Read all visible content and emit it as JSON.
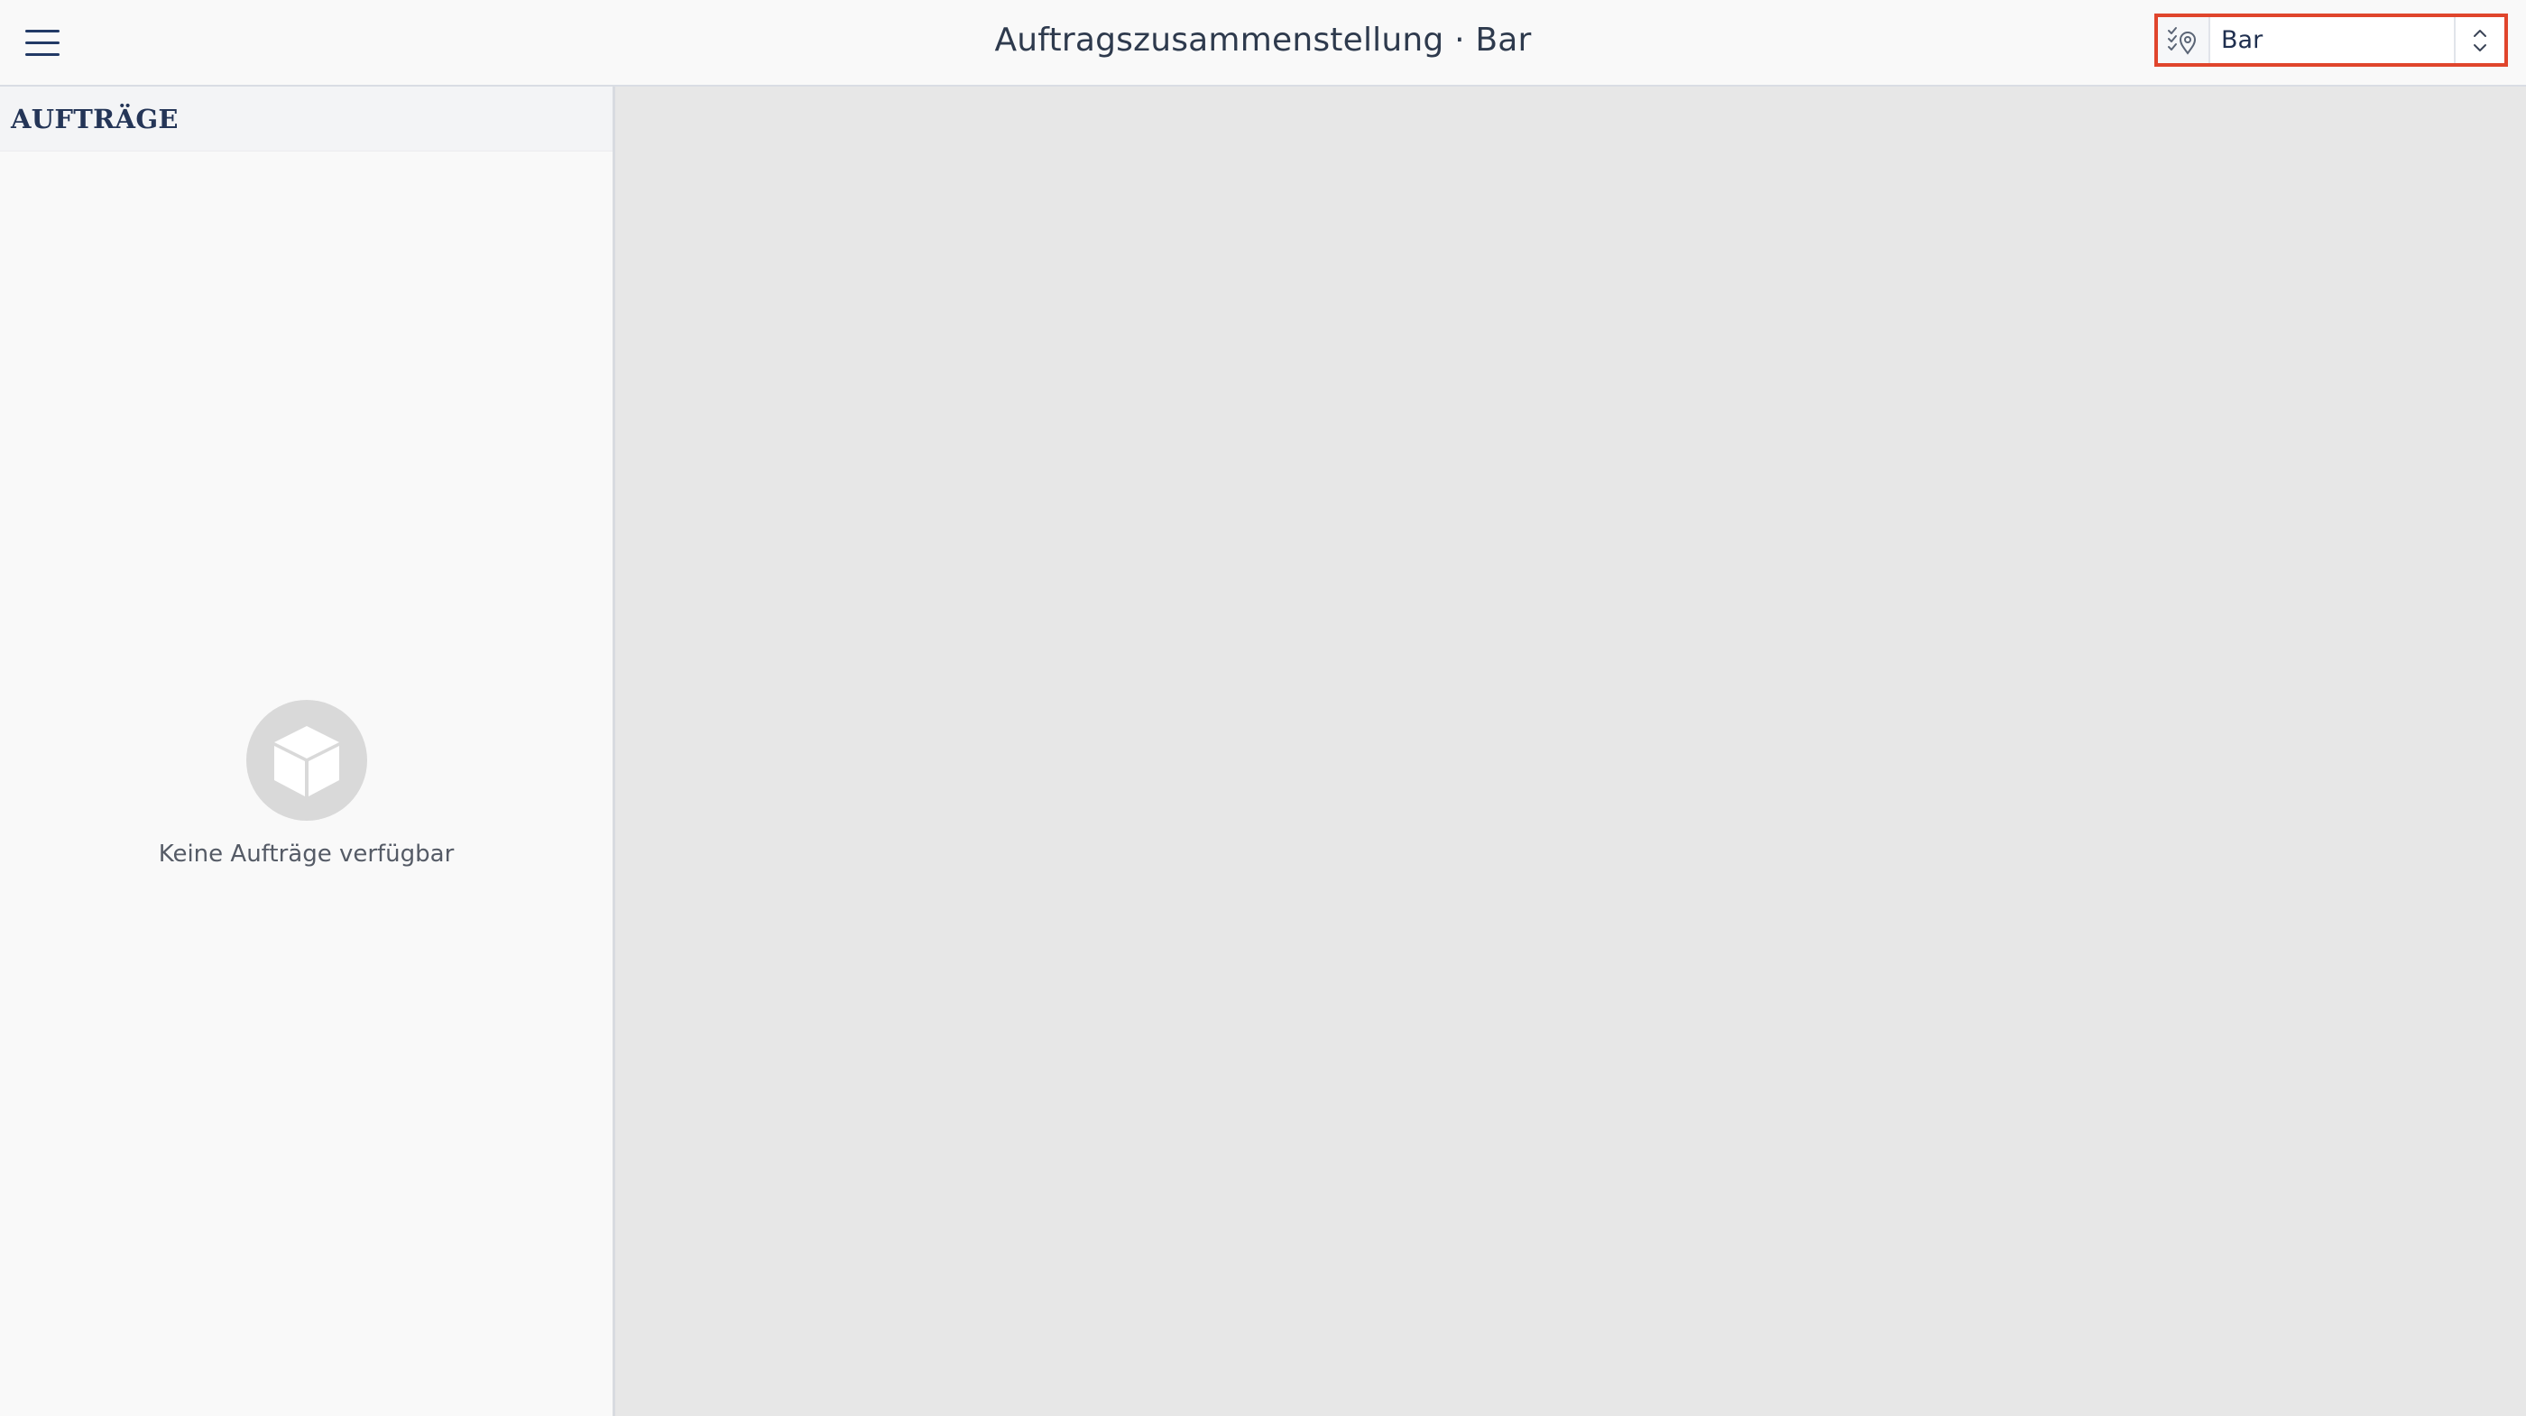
{
  "header": {
    "title": "Auftragszusammenstellung · Bar",
    "menu_icon": "hamburger-menu-icon"
  },
  "location_selector": {
    "value": "Bar",
    "icon": "location-check-icon",
    "highlight_color": "#e0452c"
  },
  "sidebar": {
    "heading": "AUFTRÄGE",
    "empty_state": {
      "icon": "cube-icon",
      "message": "Keine Aufträge verfügbar"
    }
  },
  "colors": {
    "accent": "#223a66",
    "content_background": "#e7e7e7",
    "sidebar_background": "#f9f9f9"
  }
}
